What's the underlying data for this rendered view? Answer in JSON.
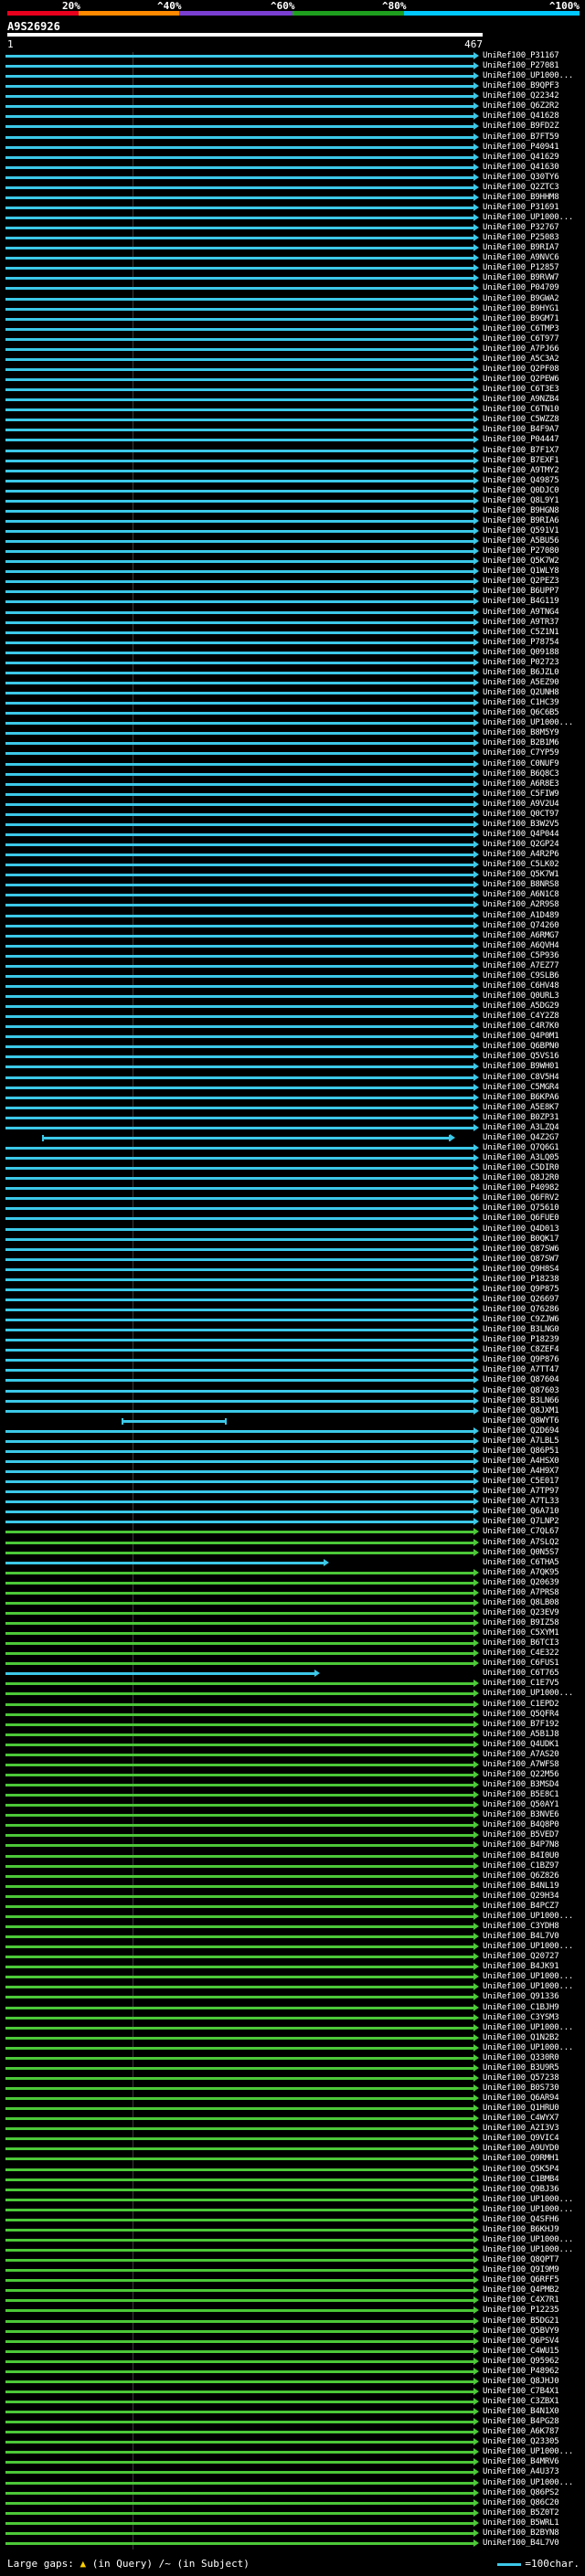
{
  "scale": {
    "ticks": [
      "20%",
      "^40%",
      "^60%",
      "^80%",
      "^100%"
    ],
    "colors": [
      "#e8001c",
      "#ff8a00",
      "#7a3fd1",
      "#1ea01e",
      "#00c8ff"
    ]
  },
  "query": {
    "title": "A9S26926",
    "start": "1",
    "end": "467"
  },
  "colors": {
    "cyan": "#3cc8e8",
    "green": "#4cc838",
    "vline": "#3a3a3a"
  },
  "hits": [
    {
      "label": "UniRef100_P31167",
      "c": "cyan"
    },
    {
      "label": "UniRef100_P27081",
      "c": "cyan"
    },
    {
      "label": "UniRef100_UP1000...",
      "c": "cyan"
    },
    {
      "label": "UniRef100_B9QPF3",
      "c": "cyan"
    },
    {
      "label": "UniRef100_Q22342",
      "c": "cyan"
    },
    {
      "label": "UniRef100_Q6Z2R2",
      "c": "cyan"
    },
    {
      "label": "UniRef100_Q41628",
      "c": "cyan"
    },
    {
      "label": "UniRef100_B9FD2Z",
      "c": "cyan"
    },
    {
      "label": "UniRef100_B7FT59",
      "c": "cyan"
    },
    {
      "label": "UniRef100_P40941",
      "c": "cyan"
    },
    {
      "label": "UniRef100_Q41629",
      "c": "cyan"
    },
    {
      "label": "UniRef100_Q41630",
      "c": "cyan"
    },
    {
      "label": "UniRef100_Q30TY6",
      "c": "cyan"
    },
    {
      "label": "UniRef100_Q2ZTC3",
      "c": "cyan"
    },
    {
      "label": "UniRef100_B9HHM8",
      "c": "cyan"
    },
    {
      "label": "UniRef100_P31691",
      "c": "cyan"
    },
    {
      "label": "UniRef100_UP1000...",
      "c": "cyan"
    },
    {
      "label": "UniRef100_P32767",
      "c": "cyan"
    },
    {
      "label": "UniRef100_P25083",
      "c": "cyan"
    },
    {
      "label": "UniRef100_B9RIA7",
      "c": "cyan"
    },
    {
      "label": "UniRef100_A9NVC6",
      "c": "cyan"
    },
    {
      "label": "UniRef100_P12857",
      "c": "cyan"
    },
    {
      "label": "UniRef100_B9RVW7",
      "c": "cyan"
    },
    {
      "label": "UniRef100_P04709",
      "c": "cyan"
    },
    {
      "label": "UniRef100_B9GWA2",
      "c": "cyan"
    },
    {
      "label": "UniRef100_B9HYG1",
      "c": "cyan"
    },
    {
      "label": "UniRef100_B9GM71",
      "c": "cyan"
    },
    {
      "label": "UniRef100_C6TMP3",
      "c": "cyan"
    },
    {
      "label": "UniRef100_C6T977",
      "c": "cyan"
    },
    {
      "label": "UniRef100_A7PJ66",
      "c": "cyan"
    },
    {
      "label": "UniRef100_A5C3A2",
      "c": "cyan"
    },
    {
      "label": "UniRef100_Q2PF08",
      "c": "cyan"
    },
    {
      "label": "UniRef100_Q2PEW6",
      "c": "cyan"
    },
    {
      "label": "UniRef100_C6T3E3",
      "c": "cyan"
    },
    {
      "label": "UniRef100_A9NZB4",
      "c": "cyan"
    },
    {
      "label": "UniRef100_C6TN10",
      "c": "cyan"
    },
    {
      "label": "UniRef100_C5WZZ8",
      "c": "cyan"
    },
    {
      "label": "UniRef100_B4F9A7",
      "c": "cyan"
    },
    {
      "label": "UniRef100_P04447",
      "c": "cyan"
    },
    {
      "label": "UniRef100_B7F1X7",
      "c": "cyan"
    },
    {
      "label": "UniRef100_B7EXF1",
      "c": "cyan"
    },
    {
      "label": "UniRef100_A9TMY2",
      "c": "cyan"
    },
    {
      "label": "UniRef100_Q49875",
      "c": "cyan"
    },
    {
      "label": "UniRef100_Q0DJC0",
      "c": "cyan"
    },
    {
      "label": "UniRef100_Q8L9Y1",
      "c": "cyan"
    },
    {
      "label": "UniRef100_B9HGN8",
      "c": "cyan"
    },
    {
      "label": "UniRef100_B9RIA6",
      "c": "cyan"
    },
    {
      "label": "UniRef100_Q591V1",
      "c": "cyan"
    },
    {
      "label": "UniRef100_A5BU56",
      "c": "cyan"
    },
    {
      "label": "UniRef100_P27080",
      "c": "cyan"
    },
    {
      "label": "UniRef100_Q5K7W2",
      "c": "cyan"
    },
    {
      "label": "UniRef100_Q1WLY8",
      "c": "cyan"
    },
    {
      "label": "UniRef100_Q2PEZ3",
      "c": "cyan"
    },
    {
      "label": "UniRef100_B6UPP7",
      "c": "cyan"
    },
    {
      "label": "UniRef100_B4G119",
      "c": "cyan"
    },
    {
      "label": "UniRef100_A9TNG4",
      "c": "cyan"
    },
    {
      "label": "UniRef100_A9TR37",
      "c": "cyan"
    },
    {
      "label": "UniRef100_C5Z1N1",
      "c": "cyan"
    },
    {
      "label": "UniRef100_P78754",
      "c": "cyan"
    },
    {
      "label": "UniRef100_Q09188",
      "c": "cyan"
    },
    {
      "label": "UniRef100_P02723",
      "c": "cyan"
    },
    {
      "label": "UniRef100_B6JZL0",
      "c": "cyan"
    },
    {
      "label": "UniRef100_A5EZ90",
      "c": "cyan"
    },
    {
      "label": "UniRef100_Q2UNH8",
      "c": "cyan"
    },
    {
      "label": "UniRef100_C1HC39",
      "c": "cyan"
    },
    {
      "label": "UniRef100_Q6C6B5",
      "c": "cyan"
    },
    {
      "label": "UniRef100_UP1000...",
      "c": "cyan"
    },
    {
      "label": "UniRef100_B8M5Y9",
      "c": "cyan"
    },
    {
      "label": "UniRef100_B2B1M6",
      "c": "cyan"
    },
    {
      "label": "UniRef100_C7YP59",
      "c": "cyan"
    },
    {
      "label": "UniRef100_C0NUF9",
      "c": "cyan"
    },
    {
      "label": "UniRef100_B6Q8C3",
      "c": "cyan"
    },
    {
      "label": "UniRef100_A6R8E3",
      "c": "cyan"
    },
    {
      "label": "UniRef100_C5FIW9",
      "c": "cyan"
    },
    {
      "label": "UniRef100_A9V2U4",
      "c": "cyan"
    },
    {
      "label": "UniRef100_Q0CT97",
      "c": "cyan"
    },
    {
      "label": "UniRef100_B3W2V5",
      "c": "cyan"
    },
    {
      "label": "UniRef100_Q4P044",
      "c": "cyan"
    },
    {
      "label": "UniRef100_Q2GP24",
      "c": "cyan"
    },
    {
      "label": "UniRef100_A4R2P6",
      "c": "cyan"
    },
    {
      "label": "UniRef100_C5LK02",
      "c": "cyan"
    },
    {
      "label": "UniRef100_Q5K7W1",
      "c": "cyan"
    },
    {
      "label": "UniRef100_B8NRS8",
      "c": "cyan"
    },
    {
      "label": "UniRef100_A6N1C8",
      "c": "cyan"
    },
    {
      "label": "UniRef100_A2R9S8",
      "c": "cyan"
    },
    {
      "label": "UniRef100_A1D489",
      "c": "cyan"
    },
    {
      "label": "UniRef100_Q74260",
      "c": "cyan"
    },
    {
      "label": "UniRef100_A6RMG7",
      "c": "cyan"
    },
    {
      "label": "UniRef100_A6QVH4",
      "c": "cyan"
    },
    {
      "label": "UniRef100_C5P936",
      "c": "cyan"
    },
    {
      "label": "UniRef100_A7EZ77",
      "c": "cyan"
    },
    {
      "label": "UniRef100_C9SLB6",
      "c": "cyan"
    },
    {
      "label": "UniRef100_C6HV48",
      "c": "cyan"
    },
    {
      "label": "UniRef100_Q0URL3",
      "c": "cyan"
    },
    {
      "label": "UniRef100_A5DG29",
      "c": "cyan"
    },
    {
      "label": "UniRef100_C4Y2Z8",
      "c": "cyan"
    },
    {
      "label": "UniRef100_C4R7K0",
      "c": "cyan"
    },
    {
      "label": "UniRef100_Q4P0M1",
      "c": "cyan"
    },
    {
      "label": "UniRef100_Q6BPN0",
      "c": "cyan"
    },
    {
      "label": "UniRef100_Q5VS16",
      "c": "cyan"
    },
    {
      "label": "UniRef100_B9WH01",
      "c": "cyan"
    },
    {
      "label": "UniRef100_C8V5H4",
      "c": "cyan"
    },
    {
      "label": "UniRef100_C5MGR4",
      "c": "cyan"
    },
    {
      "label": "UniRef100_B6KPA6",
      "c": "cyan"
    },
    {
      "label": "UniRef100_A5E8K7",
      "c": "cyan"
    },
    {
      "label": "UniRef100_B0ZP31",
      "c": "cyan"
    },
    {
      "label": "UniRef100_A3LZQ4",
      "c": "cyan"
    },
    {
      "label": "UniRef100_Q4Z2G7",
      "c": "cyan",
      "x0": 0.08,
      "x1": 0.95,
      "arrow": true,
      "caps": true
    },
    {
      "label": "UniRef100_Q7Q6G1",
      "c": "cyan"
    },
    {
      "label": "UniRef100_A3LQ05",
      "c": "cyan"
    },
    {
      "label": "UniRef100_C5DIR0",
      "c": "cyan"
    },
    {
      "label": "UniRef100_Q8J2R0",
      "c": "cyan"
    },
    {
      "label": "UniRef100_P40982",
      "c": "cyan"
    },
    {
      "label": "UniRef100_Q6FRV2",
      "c": "cyan"
    },
    {
      "label": "UniRef100_Q75610",
      "c": "cyan"
    },
    {
      "label": "UniRef100_Q6FUE0",
      "c": "cyan"
    },
    {
      "label": "UniRef100_Q4D013",
      "c": "cyan"
    },
    {
      "label": "UniRef100_B0QK17",
      "c": "cyan"
    },
    {
      "label": "UniRef100_Q87SW6",
      "c": "cyan"
    },
    {
      "label": "UniRef100_Q87SW7",
      "c": "cyan"
    },
    {
      "label": "UniRef100_Q9H8S4",
      "c": "cyan"
    },
    {
      "label": "UniRef100_P18238",
      "c": "cyan"
    },
    {
      "label": "UniRef100_Q9P875",
      "c": "cyan"
    },
    {
      "label": "UniRef100_Q26697",
      "c": "cyan"
    },
    {
      "label": "UniRef100_Q76286",
      "c": "cyan"
    },
    {
      "label": "UniRef100_C9ZJW6",
      "c": "cyan"
    },
    {
      "label": "UniRef100_B3LNG0",
      "c": "cyan"
    },
    {
      "label": "UniRef100_P18239",
      "c": "cyan"
    },
    {
      "label": "UniRef100_C8ZEF4",
      "c": "cyan"
    },
    {
      "label": "UniRef100_Q9P876",
      "c": "cyan"
    },
    {
      "label": "UniRef100_A7TT47",
      "c": "cyan"
    },
    {
      "label": "UniRef100_Q87604",
      "c": "cyan"
    },
    {
      "label": "UniRef100_Q87603",
      "c": "cyan"
    },
    {
      "label": "UniRef100_B3LN66",
      "c": "cyan"
    },
    {
      "label": "UniRef100_Q8JXM1",
      "c": "cyan"
    },
    {
      "label": "UniRef100_Q8WYT6",
      "c": "cyan",
      "x0": 0.25,
      "x1": 0.47,
      "caps": true
    },
    {
      "label": "UniRef100_Q2D694",
      "c": "cyan"
    },
    {
      "label": "UniRef100_A7LBL5",
      "c": "cyan"
    },
    {
      "label": "UniRef100_Q86P51",
      "c": "cyan"
    },
    {
      "label": "UniRef100_A4HSX0",
      "c": "cyan"
    },
    {
      "label": "UniRef100_A4H9X7",
      "c": "cyan"
    },
    {
      "label": "UniRef100_C5E017",
      "c": "cyan"
    },
    {
      "label": "UniRef100_A7TP97",
      "c": "cyan"
    },
    {
      "label": "UniRef100_A7TL33",
      "c": "cyan"
    },
    {
      "label": "UniRef100_Q6A710",
      "c": "cyan"
    },
    {
      "label": "UniRef100_Q7LNP2",
      "c": "cyan"
    },
    {
      "label": "UniRef100_C7QL67",
      "c": "green"
    },
    {
      "label": "UniRef100_A7SLQ2",
      "c": "green"
    },
    {
      "label": "UniRef100_Q0N5S7",
      "c": "green"
    },
    {
      "label": "UniRef100_C6THA5",
      "c": "cyan",
      "x0": 0.0,
      "x1": 0.68,
      "arrow": true
    },
    {
      "label": "UniRef100_A7QK95",
      "c": "green"
    },
    {
      "label": "UniRef100_Q20639",
      "c": "green"
    },
    {
      "label": "UniRef100_A7PRS8",
      "c": "green"
    },
    {
      "label": "UniRef100_Q8LB08",
      "c": "green"
    },
    {
      "label": "UniRef100_Q23EV9",
      "c": "green"
    },
    {
      "label": "UniRef100_B9IZ58",
      "c": "green"
    },
    {
      "label": "UniRef100_C5XYM1",
      "c": "green"
    },
    {
      "label": "UniRef100_B6TCI3",
      "c": "green"
    },
    {
      "label": "UniRef100_C4E322",
      "c": "green"
    },
    {
      "label": "UniRef100_C6FUS1",
      "c": "green"
    },
    {
      "label": "UniRef100_C6T765",
      "c": "cyan",
      "x0": 0.0,
      "x1": 0.66,
      "arrow": true
    },
    {
      "label": "UniRef100_C1E7V5",
      "c": "green"
    },
    {
      "label": "UniRef100_UP1000...",
      "c": "green"
    },
    {
      "label": "UniRef100_C1EPD2",
      "c": "green"
    },
    {
      "label": "UniRef100_Q5QFR4",
      "c": "green"
    },
    {
      "label": "UniRef100_B7F192",
      "c": "green"
    },
    {
      "label": "UniRef100_A5B1J8",
      "c": "green"
    },
    {
      "label": "UniRef100_Q4UDK1",
      "c": "green"
    },
    {
      "label": "UniRef100_A7AS20",
      "c": "green"
    },
    {
      "label": "UniRef100_A7WFS8",
      "c": "green"
    },
    {
      "label": "UniRef100_Q22M56",
      "c": "green"
    },
    {
      "label": "UniRef100_B3MSD4",
      "c": "green"
    },
    {
      "label": "UniRef100_B5E8C1",
      "c": "green"
    },
    {
      "label": "UniRef100_Q50AY1",
      "c": "green"
    },
    {
      "label": "UniRef100_B3NVE6",
      "c": "green"
    },
    {
      "label": "UniRef100_B4Q8P0",
      "c": "green"
    },
    {
      "label": "UniRef100_B5VED7",
      "c": "green"
    },
    {
      "label": "UniRef100_B4P7N8",
      "c": "green"
    },
    {
      "label": "UniRef100_B4I0U0",
      "c": "green"
    },
    {
      "label": "UniRef100_C1BZ97",
      "c": "green"
    },
    {
      "label": "UniRef100_Q6Z826",
      "c": "green"
    },
    {
      "label": "UniRef100_B4NL19",
      "c": "green"
    },
    {
      "label": "UniRef100_Q29H34",
      "c": "green"
    },
    {
      "label": "UniRef100_B4PCZ7",
      "c": "green"
    },
    {
      "label": "UniRef100_UP1000...",
      "c": "green"
    },
    {
      "label": "UniRef100_C3YDH8",
      "c": "green"
    },
    {
      "label": "UniRef100_B4L7V0",
      "c": "green"
    },
    {
      "label": "UniRef100_UP1000...",
      "c": "green"
    },
    {
      "label": "UniRef100_Q20727",
      "c": "green"
    },
    {
      "label": "UniRef100_B4JK91",
      "c": "green"
    },
    {
      "label": "UniRef100_UP1000...",
      "c": "green"
    },
    {
      "label": "UniRef100_UP1000...",
      "c": "green"
    },
    {
      "label": "UniRef100_Q91336",
      "c": "green"
    },
    {
      "label": "UniRef100_C1BJH9",
      "c": "green"
    },
    {
      "label": "UniRef100_C3YSM3",
      "c": "green"
    },
    {
      "label": "UniRef100_UP1000...",
      "c": "green"
    },
    {
      "label": "UniRef100_Q1N2B2",
      "c": "green"
    },
    {
      "label": "UniRef100_UP1000...",
      "c": "green"
    },
    {
      "label": "UniRef100_Q330R0",
      "c": "green"
    },
    {
      "label": "UniRef100_B3U9R5",
      "c": "green"
    },
    {
      "label": "UniRef100_Q57238",
      "c": "green"
    },
    {
      "label": "UniRef100_B0S730",
      "c": "green"
    },
    {
      "label": "UniRef100_Q6AR94",
      "c": "green"
    },
    {
      "label": "UniRef100_Q1HRU0",
      "c": "green"
    },
    {
      "label": "UniRef100_C4WYX7",
      "c": "green"
    },
    {
      "label": "UniRef100_A2I3V3",
      "c": "green"
    },
    {
      "label": "UniRef100_Q9VIC4",
      "c": "green"
    },
    {
      "label": "UniRef100_A9UYD0",
      "c": "green"
    },
    {
      "label": "UniRef100_Q9RMH1",
      "c": "green"
    },
    {
      "label": "UniRef100_Q5K5P4",
      "c": "green"
    },
    {
      "label": "UniRef100_C1BMB4",
      "c": "green"
    },
    {
      "label": "UniRef100_Q9BJ36",
      "c": "green"
    },
    {
      "label": "UniRef100_UP1000...",
      "c": "green"
    },
    {
      "label": "UniRef100_UP1000...",
      "c": "green"
    },
    {
      "label": "UniRef100_Q4SFH6",
      "c": "green"
    },
    {
      "label": "UniRef100_B6KHJ9",
      "c": "green"
    },
    {
      "label": "UniRef100_UP1000...",
      "c": "green"
    },
    {
      "label": "UniRef100_UP1000...",
      "c": "green"
    },
    {
      "label": "UniRef100_Q8QPT7",
      "c": "green"
    },
    {
      "label": "UniRef100_Q9I9M9",
      "c": "green"
    },
    {
      "label": "UniRef100_Q6RFF5",
      "c": "green"
    },
    {
      "label": "UniRef100_Q4PMB2",
      "c": "green"
    },
    {
      "label": "UniRef100_C4X7R1",
      "c": "green"
    },
    {
      "label": "UniRef100_P12235",
      "c": "green"
    },
    {
      "label": "UniRef100_B5DG21",
      "c": "green"
    },
    {
      "label": "UniRef100_Q5BVY9",
      "c": "green"
    },
    {
      "label": "UniRef100_Q6PSV4",
      "c": "green"
    },
    {
      "label": "UniRef100_C4WU15",
      "c": "green"
    },
    {
      "label": "UniRef100_Q95962",
      "c": "green"
    },
    {
      "label": "UniRef100_P48962",
      "c": "green"
    },
    {
      "label": "UniRef100_Q8JHJ0",
      "c": "green"
    },
    {
      "label": "UniRef100_C7B4X1",
      "c": "green"
    },
    {
      "label": "UniRef100_C3ZBX1",
      "c": "green"
    },
    {
      "label": "UniRef100_B4N1X0",
      "c": "green"
    },
    {
      "label": "UniRef100_B4PG28",
      "c": "green"
    },
    {
      "label": "UniRef100_A6K787",
      "c": "green"
    },
    {
      "label": "UniRef100_Q23305",
      "c": "green"
    },
    {
      "label": "UniRef100_UP1000...",
      "c": "green"
    },
    {
      "label": "UniRef100_B4MRV6",
      "c": "green"
    },
    {
      "label": "UniRef100_A4U373",
      "c": "green"
    },
    {
      "label": "UniRef100_UP1000...",
      "c": "green"
    },
    {
      "label": "UniRef100_Q86PS2",
      "c": "green"
    },
    {
      "label": "UniRef100_Q86C20",
      "c": "green"
    },
    {
      "label": "UniRef100_B5Z0T2",
      "c": "green"
    },
    {
      "label": "UniRef100_B5WRL1",
      "c": "green"
    },
    {
      "label": "UniRef100_B2BYN8",
      "c": "green"
    },
    {
      "label": "UniRef100_B4L7V0",
      "c": "green"
    }
  ],
  "footer": {
    "gaps_label": "Large gaps:",
    "gaps_query": "(in Query)",
    "gaps_subject": "/~ (in Subject)",
    "legend_label": "=100char."
  }
}
